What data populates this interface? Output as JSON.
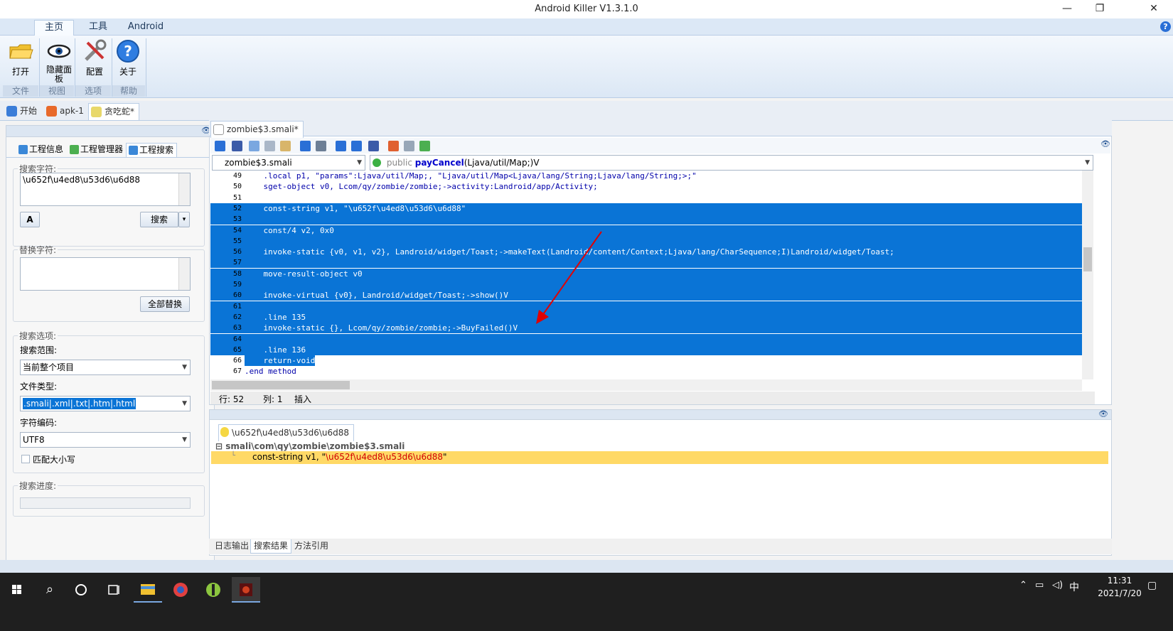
{
  "window": {
    "title": "Android Killer V1.3.1.0",
    "controls": [
      "—",
      "❐",
      "✕"
    ]
  },
  "ribbon": {
    "tabs": [
      "主页",
      "工具",
      "Android"
    ],
    "buttons": [
      {
        "label": "打开",
        "icon": "folder-open-icon"
      },
      {
        "label": "隐藏面板",
        "icon": "eye-icon"
      },
      {
        "label": "配置",
        "icon": "tools-icon"
      },
      {
        "label": "关于",
        "icon": "help-icon"
      }
    ],
    "groups": [
      "文件",
      "视图",
      "选项",
      "帮助"
    ],
    "help_glyph": "?"
  },
  "doc_tabs": [
    "开始",
    "apk-1",
    "贪吃蛇*"
  ],
  "left_panel": {
    "tabs": [
      "工程信息",
      "工程管理器",
      "工程搜索"
    ],
    "search": {
      "legend": "搜索字符:",
      "value": "\\u652f\\u4ed8\\u53d6\\u6d88",
      "search_button": "搜索",
      "dropdown_glyph": "▾"
    },
    "replace": {
      "legend": "替换字符:",
      "value": "",
      "replace_all_button": "全部替换"
    },
    "options": {
      "legend": "搜索选项:",
      "scope_label": "搜索范围:",
      "scope_value": "当前整个项目",
      "filetype_label": "文件类型:",
      "filetype_value": ".smali|.xml|.txt|.htm|.html",
      "encoding_label": "字符编码:",
      "encoding_value": "UTF8",
      "match_case_label": "匹配大小写",
      "match_case_checked": false
    },
    "progress": {
      "legend": "搜索进度:",
      "value": 0
    }
  },
  "editor": {
    "tab": "zombie$3.smali*",
    "file_combo": "zombie$3.smali",
    "method_combo_prefix": "public",
    "method_combo_name": "payCancel",
    "method_combo_sig": "(Ljava/util/Map;)V",
    "lines": [
      {
        "n": "49",
        "text": "    .local p1, \"params\":Ljava/util/Map;, \"Ljava/util/Map<Ljava/lang/String;Ljava/lang/String;>;\"",
        "sel": false
      },
      {
        "n": "50",
        "text": "    sget-object v0, Lcom/qy/zombie/zombie;->activity:Landroid/app/Activity;",
        "sel": false
      },
      {
        "n": "51",
        "text": "",
        "sel": false
      },
      {
        "n": "52",
        "text": "    const-string v1, \"\\u652f\\u4ed8\\u53d6\\u6d88\"",
        "sel": true
      },
      {
        "n": "53",
        "text": "",
        "sel": true
      },
      {
        "n": "54",
        "text": "    const/4 v2, 0x0",
        "sel": true
      },
      {
        "n": "55",
        "text": "",
        "sel": true
      },
      {
        "n": "56",
        "text": "    invoke-static {v0, v1, v2}, Landroid/widget/Toast;->makeText(Landroid/content/Context;Ljava/lang/CharSequence;I)Landroid/widget/Toast;",
        "sel": true
      },
      {
        "n": "57",
        "text": "",
        "sel": true
      },
      {
        "n": "58",
        "text": "    move-result-object v0",
        "sel": true
      },
      {
        "n": "59",
        "text": "",
        "sel": true
      },
      {
        "n": "60",
        "text": "    invoke-virtual {v0}, Landroid/widget/Toast;->show()V",
        "sel": true
      },
      {
        "n": "61",
        "text": "",
        "sel": true
      },
      {
        "n": "62",
        "text": "    .line 135",
        "sel": true
      },
      {
        "n": "63",
        "text": "    invoke-static {}, Lcom/qy/zombie/zombie;->BuyFailed()V",
        "sel": true
      },
      {
        "n": "64",
        "text": "",
        "sel": true
      },
      {
        "n": "65",
        "text": "    .line 136",
        "sel": true
      },
      {
        "n": "66",
        "text": "    return-void",
        "sel": "partial"
      },
      {
        "n": "67",
        "text": ".end method",
        "sel": false
      }
    ],
    "status": {
      "row": "行: 52",
      "col": "列: 1",
      "mode": "插入"
    }
  },
  "results": {
    "tab": "\\u652f\\u4ed8\\u53d6\\u6d88",
    "file": "smali\\com\\qy\\zombie\\zombie$3.smali",
    "match_prefix": "const-string v1, \"",
    "match_hit": "\\u652f\\u4ed8\\u53d6\\u6d88",
    "match_suffix": "\"",
    "bottom_tabs": [
      "日志输出",
      "搜索结果",
      "方法引用"
    ]
  },
  "taskbar": {
    "ime": "中",
    "time": "11:31",
    "date": "2021/7/20"
  },
  "colors": {
    "selection": "#0a74d6",
    "annotation_arrow": "#e00000",
    "result_highlight": "#ffd966",
    "taskbar": "#1f1f1f"
  }
}
